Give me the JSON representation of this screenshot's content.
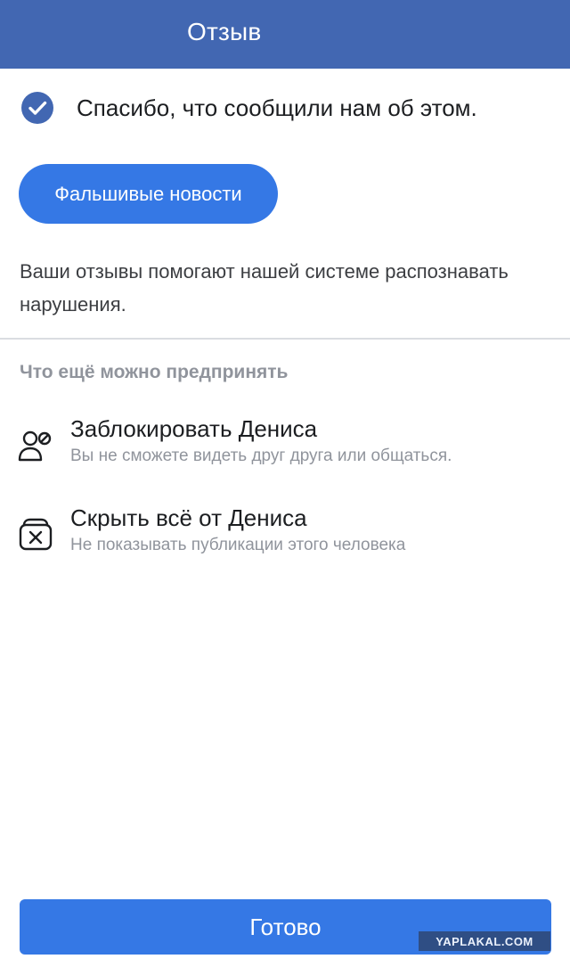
{
  "header": {
    "title": "Отзыв",
    "color": "#4267b2"
  },
  "confirmation": {
    "icon": "check-circle-icon",
    "text": "Спасибо, что сообщили нам об этом."
  },
  "report_tag": {
    "label": "Фальшивые новости",
    "color": "#3578e5"
  },
  "feedback_note": "Ваши отзывы помогают нашей системе распознавать нарушения.",
  "more_actions": {
    "heading": "Что ещё можно предпринять",
    "items": [
      {
        "icon": "block-user-icon",
        "title": "Заблокировать Дениса",
        "subtitle": "Вы не сможете видеть друг друга или общаться."
      },
      {
        "icon": "hide-all-icon",
        "title": "Скрыть всё от Дениса",
        "subtitle": "Не показывать публикации этого человека"
      }
    ]
  },
  "footer": {
    "done_label": "Готово",
    "watermark": "YAPLAKAL.COM"
  }
}
